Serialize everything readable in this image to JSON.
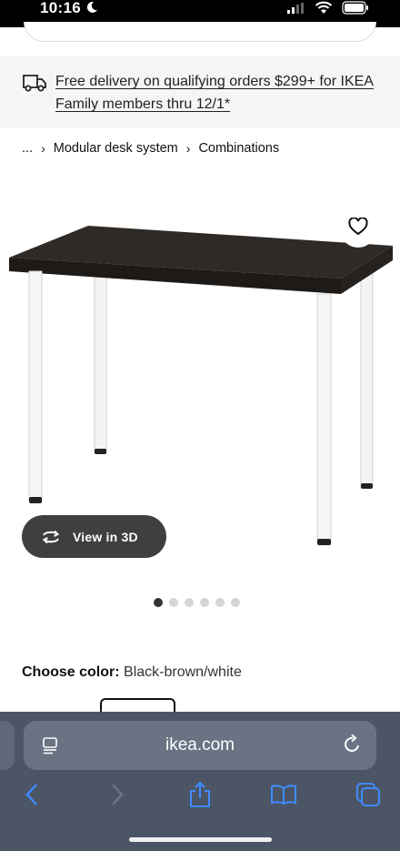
{
  "status_bar": {
    "time": "10:16",
    "icons": [
      "moon-icon",
      "signal-icon",
      "wifi-icon",
      "battery-icon"
    ]
  },
  "delivery_banner": {
    "icon": "truck-icon",
    "text": "Free delivery on qualifying orders $299+ for IKEA Family members thru 12/1*"
  },
  "breadcrumb": {
    "ellipsis": "...",
    "items": [
      "Modular desk system",
      "Combinations"
    ]
  },
  "product_image": {
    "favorite_icon": "heart-icon",
    "view_3d_label": "View in 3D",
    "view_3d_icon": "rotate-icon",
    "carousel": {
      "count": 6,
      "active_index": 0
    }
  },
  "color_selector": {
    "label": "Choose color:",
    "value": "Black-brown/white"
  },
  "safari": {
    "url": "ikea.com",
    "icons": [
      "reader-icon",
      "reload-icon",
      "back-icon",
      "forward-icon",
      "share-icon",
      "bookmarks-icon",
      "tabs-icon"
    ]
  },
  "colors": {
    "tabletop": "#2f2a26",
    "legs": "#f4f4f4",
    "safari_accent": "#3f8cff",
    "banner_bg": "#f5f5f5"
  }
}
